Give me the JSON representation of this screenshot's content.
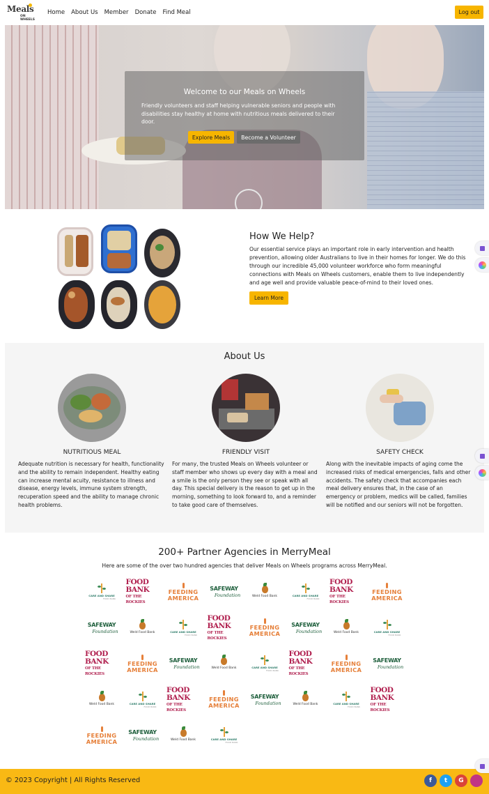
{
  "nav": {
    "logo_text": "Meals",
    "logo_sub": "ON WHEELS",
    "links": [
      "Home",
      "About Us",
      "Member",
      "Donate",
      "Find Meal"
    ],
    "logout_label": "Log out"
  },
  "hero": {
    "title": "Welcome to our Meals on Wheels",
    "text": "Friendly volunteers and staff helping vulnerable seniors and people with disabilities stay healthy at home with nutritious meals delivered to their door.",
    "btn_primary": "Explore Meals",
    "btn_secondary": "Become a Volunteer"
  },
  "help": {
    "title": "How We Help?",
    "text": "Our essential service plays an important role in early intervention and health prevention, allowing older Australians to live in their homes for longer. We do this through our incredible 45,000 volunteer workforce who form meaningful connections with Meals on Wheels customers, enable them to live independently and age well and provide valuable peace-of-mind to their loved ones.",
    "button": "Learn More"
  },
  "about": {
    "title": "About Us",
    "items": [
      {
        "heading": "NUTRITIOUS MEAL",
        "text": "Adequate nutrition is necessary for health, functionality and the ability to remain independent. Healthy eating can increase mental acuity, resistance to illness and disease, energy levels, immune system strength, recuperation speed and the ability to manage chronic health problems."
      },
      {
        "heading": "FRIENDLY VISIT",
        "text": "For many, the trusted Meals on Wheels volunteer or staff member who shows up every day with a meal and a smile is the only person they see or speak with all day. This special delivery is the reason to get up in the morning, something to look forward to, and a reminder to take good care of themselves."
      },
      {
        "heading": "SAFETY CHECK",
        "text": "Along with the inevitable impacts of aging come the increased risks of medical emergencies, falls and other accidents. The safety check that accompanies each meal delivery ensures that, in the case of an emergency or problem, medics will be called, families will be notified and our seniors will not be forgotten."
      }
    ]
  },
  "partners": {
    "title": "200+ Partner Agencies in MerryMeal",
    "subtitle": "Here are some of the over two hundred agencies that deliver Meals on Wheels programs across MerryMeal.",
    "logo_text": {
      "care_and_share": "CARE AND SHARE",
      "care_and_share_sub": "FOOD BANK",
      "food_bank_1": "FOOD BANK",
      "food_bank_2": "OF THE ROCKIES",
      "feeding_1": "FEEDING",
      "feeding_2": "AMERICA",
      "safeway_1": "SAFEWAY",
      "safeway_2": "Foundation",
      "weld": "Weld Food Bank"
    },
    "rows": [
      [
        "care",
        "foodbank",
        "feeding",
        "safeway",
        "weld",
        "care",
        "foodbank",
        "feeding"
      ],
      [
        "safeway",
        "weld",
        "care",
        "foodbank",
        "feeding",
        "safeway",
        "weld",
        "care"
      ],
      [
        "foodbank",
        "feeding",
        "safeway",
        "weld",
        "care",
        "foodbank",
        "feeding",
        "safeway"
      ],
      [
        "weld",
        "care",
        "foodbank",
        "feeding",
        "safeway",
        "weld",
        "care",
        "foodbank"
      ],
      [
        "feeding",
        "safeway",
        "weld",
        "care"
      ]
    ]
  },
  "footer": {
    "copyright": "© 2023 Copyright | All Rights Reserved",
    "social": [
      {
        "name": "facebook-icon",
        "glyph": "f",
        "color": "#3b5998"
      },
      {
        "name": "twitter-icon",
        "glyph": "t",
        "color": "#1da1f2"
      },
      {
        "name": "google-icon",
        "glyph": "G",
        "color": "#db4437"
      },
      {
        "name": "instagram-icon",
        "glyph": "",
        "color": "#c13584"
      }
    ]
  },
  "colors": {
    "accent": "#f7b500",
    "footer_bg": "#f9b914",
    "section_bg": "#f5f5f5"
  }
}
